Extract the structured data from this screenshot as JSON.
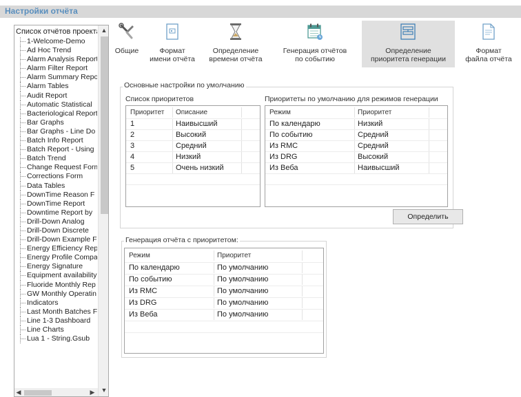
{
  "window": {
    "title": "Настройки отчёта"
  },
  "tree": {
    "root": "Список отчётов проекта",
    "items": [
      "1-Welcome-Demo",
      "Ad Hoc Trend",
      "Alarm Analysis Report",
      "Alarm Filter Report",
      "Alarm Summary Report",
      "Alarm Tables",
      "Audit Report",
      "Automatic Statistical",
      "Bacteriological Report",
      "Bar Graphs",
      "Bar Graphs - Line Do",
      "Batch Info Report",
      "Batch Report - Using",
      "Batch Trend",
      "Change Request Form",
      "Corrections Form",
      "Data Tables",
      "DownTime Reason F",
      "DownTime Report",
      "Downtime Report by",
      "Drill-Down Analog",
      "Drill-Down Discrete",
      "Drill-Down Example F",
      "Energy Efficiency Rep",
      "Energy Profile Compa",
      "Energy Signature",
      "Equipment availability",
      "Fluoride Monthly Rep",
      "GW Monthly Operatin",
      "Indicators",
      "Last Month Batches F",
      "Line 1-3 Dashboard",
      "Line Charts",
      "Lua 1 - String.Gsub"
    ]
  },
  "toolbar": {
    "buttons": [
      {
        "name": "general",
        "label1": "Общие",
        "label2": ""
      },
      {
        "name": "name-format",
        "label1": "Формат",
        "label2": "имени отчёта"
      },
      {
        "name": "time-definition",
        "label1": "Определение",
        "label2": "времени отчёта"
      },
      {
        "name": "event-generation",
        "label1": "Генерация отчётов",
        "label2": "по событию"
      },
      {
        "name": "priority-definition",
        "label1": "Определение",
        "label2": "приоритета генерации"
      },
      {
        "name": "file-format",
        "label1": "Формат",
        "label2": "файла отчёта"
      }
    ]
  },
  "defaults": {
    "title": "Основные настройки по умолчанию",
    "priority_list": {
      "title": "Список приоритетов",
      "headers": [
        "Приоритет",
        "Описание"
      ],
      "rows": [
        [
          "1",
          "Наивысший"
        ],
        [
          "2",
          "Высокий"
        ],
        [
          "3",
          "Средний"
        ],
        [
          "4",
          "Низкий"
        ],
        [
          "5",
          "Очень низкий"
        ]
      ]
    },
    "mode_priorities": {
      "title": "Приоритеты по умолчанию для режимов генерации",
      "headers": [
        "Режим",
        "Приоритет"
      ],
      "rows": [
        [
          "По календарю",
          "Низкий"
        ],
        [
          "По событию",
          "Средний"
        ],
        [
          "Из RMC",
          "Средний"
        ],
        [
          "Из DRG",
          "Высокий"
        ],
        [
          "Из Веба",
          "Наивысший"
        ]
      ]
    },
    "define_button": "Определить"
  },
  "report_generation": {
    "title": "Генерация отчёта с приоритетом:",
    "headers": [
      "Режим",
      "Приоритет"
    ],
    "rows": [
      [
        "По календарю",
        "По умолчанию"
      ],
      [
        "По событию",
        "По умолчанию"
      ],
      [
        "Из RMC",
        "По умолчанию"
      ],
      [
        "Из DRG",
        "По умолчанию"
      ],
      [
        "Из Веба",
        "По умолчанию"
      ]
    ]
  },
  "colors": {
    "title_text": "#5a8fbe",
    "active_tab": "#e0e0e0"
  }
}
